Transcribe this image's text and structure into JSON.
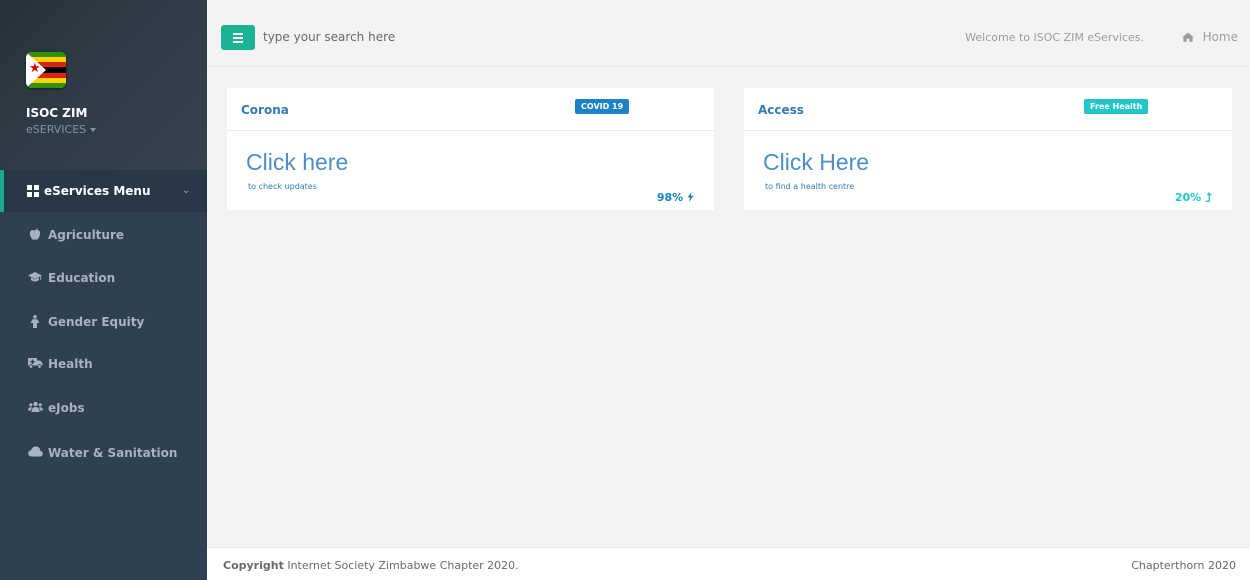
{
  "sidebar": {
    "profile": {
      "name": "ISOC ZIM",
      "subtitle": "eSERVICES"
    },
    "menu_header": "eServices Menu",
    "items": [
      {
        "label": "Agriculture",
        "icon": "apple-icon"
      },
      {
        "label": "Education",
        "icon": "graduation-cap-icon"
      },
      {
        "label": "Gender Equity",
        "icon": "person-icon"
      },
      {
        "label": "Health",
        "icon": "ambulance-icon"
      },
      {
        "label": "eJobs",
        "icon": "users-icon"
      },
      {
        "label": "Water & Sanitation",
        "icon": "cloud-icon"
      }
    ]
  },
  "topbar": {
    "search_placeholder": "type your search here",
    "welcome": "Welcome to ISOC ZIM eServices.",
    "home": "Home"
  },
  "cards": [
    {
      "title": "Corona",
      "badge": "COVID 19",
      "badge_color": "#1c84c6",
      "big": "Click here",
      "small": "to check updates",
      "pct": "98%",
      "pct_color": "#1c84c6"
    },
    {
      "title": "Access",
      "badge": "Free Health",
      "badge_color": "#23c6c8",
      "big": "Click Here",
      "small": "to find a health centre",
      "pct": "20%",
      "pct_color": "#23c6c8"
    }
  ],
  "footer": {
    "copyright_bold": "Copyright",
    "copyright_text": " Internet Society Zimbabwe Chapter 2020.",
    "right": "Chapterthorn 2020"
  },
  "colors": {
    "sidebar": "#2f4050",
    "accent": "#1ab394",
    "link": "#337ab7"
  }
}
